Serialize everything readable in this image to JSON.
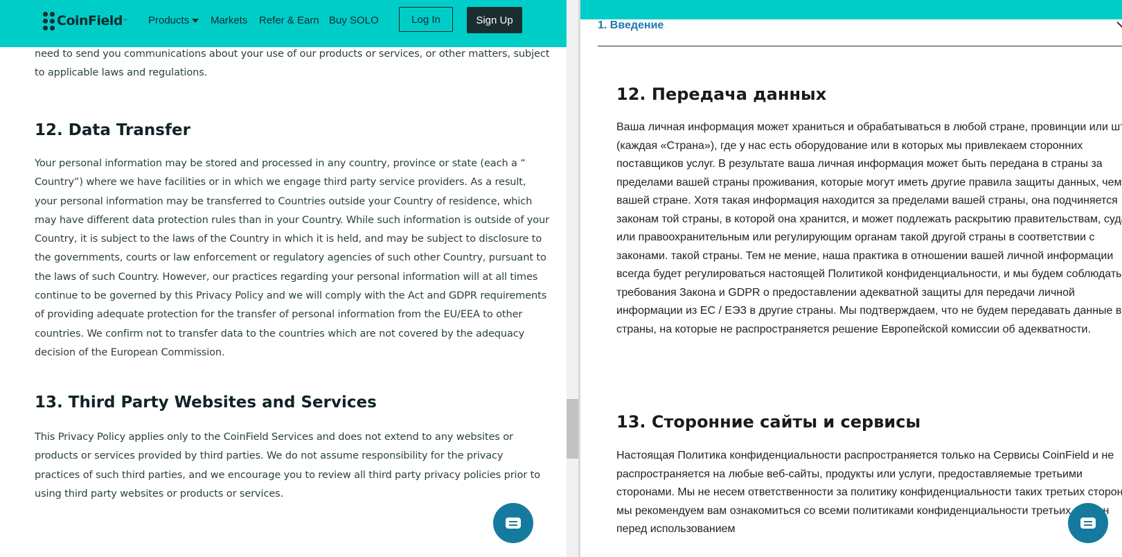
{
  "left": {
    "brand": "CoinField",
    "brand_mark": "™",
    "nav": {
      "products": "Products",
      "markets": "Markets",
      "refer": "Refer & Earn",
      "buy": "Buy SOLO",
      "login": "Log In",
      "signup": "Sign Up"
    },
    "intro_text": "need to send you communications about your use of our products or services, or other matters, subject to applicable laws and regulations.",
    "s12_title": "12. Data Transfer",
    "s12_text": "Your personal information may be stored and processed in any country, province or state (each a “ Country”) where we have facilities or in which we engage third party service providers. As a result, your personal information may be transferred to Countries outside your Country of residence, which may have different data protection rules than in your Country. While such information is outside of your Country, it is subject to the laws of the Country in which it is held, and may be subject to disclosure to the governments, courts or law enforcement or regulatory agencies of such other Country, pursuant to the laws of such Country. However, our practices regarding your personal information will at all times continue to be governed by this Privacy Policy and we will comply with the Act and GDPR requirements of providing adequate protection for the transfer of personal information from the EU/EEA to other countries. We confirm not to transfer data to the countries which are not covered by the adequacy decision of the European Commission.",
    "s13_title": "13. Third Party Websites and Services",
    "s13_text": "This Privacy Policy applies only to the CoinField Services and does not extend to any websites or products or services provided by third parties. We do not assume responsibility for the privacy practices of such third parties, and we encourage you to review all third party privacy policies prior to using third party websites or products or services."
  },
  "right": {
    "accordion_label": "1. Введение",
    "s12_title": "12. Передача данных",
    "s12_text": "Ваша личная информация может храниться и обрабатываться в любой стране, провинции или штате (каждая «Страна»), где у нас есть оборудование или в которых мы привлекаем сторонних поставщиков услуг. В результате ваша личная информация может быть передана в страны за пределами вашей страны проживания, которые могут иметь другие правила защиты данных, чем в вашей стране. Хотя такая информация находится за пределами вашей страны, она подчиняется законам той страны, в которой она хранится, и может подлежать раскрытию правительствам, судам или правоохранительным или регулирующим органам такой другой страны в соответствии с законами. такой страны. Тем не мение, наша практика в отношении вашей личной информации всегда будет регулироваться настоящей Политикой конфиденциальности, и мы будем соблюдать требования Закона и GDPR о предоставлении адекватной защиты для передачи личной информации из ЕС / ЕЭЗ в другие страны. Мы подтверждаем, что не будем передавать данные в страны, на которые не распространяется решение Европейской комиссии об адекватности.",
    "s13_title": "13. Сторонние сайты и сервисы",
    "s13_text": "Настоящая Политика конфиденциальности распространяется только на Сервисы CoinField и не распространяется на любые веб-сайты, продукты или услуги, предоставляемые третьими сторонами. Мы не несем ответственности за политику конфиденциальности таких третьих сторон, и мы рекомендуем вам ознакомиться со всеми политиками конфиденциальности третьих сторон перед использованием"
  },
  "colors": {
    "header_teal": "#00cdc8",
    "dark_button": "#1a2e31",
    "chat_button": "#157a9e",
    "link_blue": "#1f78b4"
  },
  "icons": {
    "chat": "chat-bubble-icon",
    "logo": "coinfield-logo-icon",
    "dropdown": "caret-down-icon",
    "accordion": "chevron-down-icon"
  }
}
